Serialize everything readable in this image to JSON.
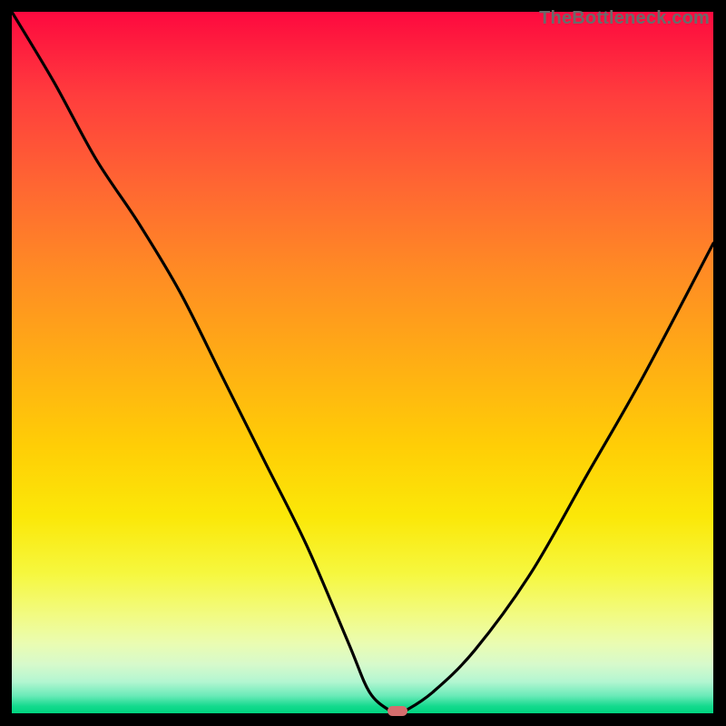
{
  "watermark": "TheBottleneck.com",
  "chart_data": {
    "type": "line",
    "title": "",
    "xlabel": "",
    "ylabel": "",
    "xlim": [
      0,
      100
    ],
    "ylim": [
      0,
      100
    ],
    "grid": false,
    "legend": false,
    "series": [
      {
        "name": "bottleneck-curve",
        "x": [
          0,
          6,
          12,
          18,
          24,
          30,
          36,
          42,
          48,
          51,
          54,
          55,
          56,
          60,
          66,
          74,
          82,
          90,
          100
        ],
        "y": [
          100,
          90,
          79,
          70,
          60,
          48,
          36,
          24,
          10,
          3,
          0.3,
          0,
          0.3,
          3,
          9,
          20,
          34,
          48,
          67
        ]
      }
    ],
    "marker": {
      "x": 55,
      "y": 0,
      "color": "#d46e6e"
    },
    "background_gradient": {
      "top": "#fe093f",
      "mid": "#ffce06",
      "bottom": "#00d480"
    }
  }
}
